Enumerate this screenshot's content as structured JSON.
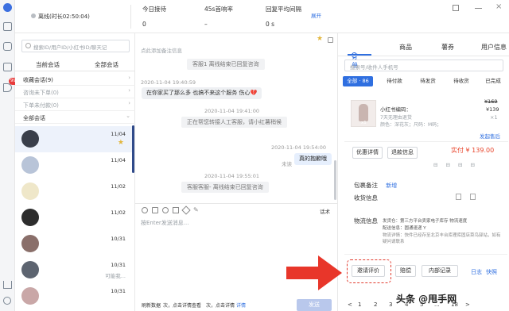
{
  "topbar": {
    "status": "离线(时长02:50:04)",
    "stats": [
      {
        "label": "今日接待",
        "value": "0"
      },
      {
        "label": "45s首响率",
        "value": "–"
      },
      {
        "label": "回复平均间隔",
        "value": "0 s"
      }
    ],
    "expand": "展开"
  },
  "rail": {
    "badge": "99+"
  },
  "sessions": {
    "search_placeholder": "搜索ID/用户ID/小红书ID/聊天记",
    "tabs": [
      "当前会话",
      "全部会话"
    ],
    "groups": [
      {
        "label": "收藏会话(9)"
      },
      {
        "label": "咨询未下单(0)"
      },
      {
        "label": "下单未付款(0)"
      },
      {
        "label": "全部会话"
      }
    ],
    "items": [
      {
        "date": "11/04",
        "starred": true,
        "preview": ""
      },
      {
        "date": "11/04",
        "starred": false,
        "preview": ""
      },
      {
        "date": "11/02",
        "starred": false,
        "preview": ""
      },
      {
        "date": "11/02",
        "starred": false,
        "preview": ""
      },
      {
        "date": "10/31",
        "starred": false,
        "preview": ""
      },
      {
        "date": "10/31",
        "starred": false,
        "preview": "可能我..."
      },
      {
        "date": "10/31",
        "starred": false,
        "preview": ""
      }
    ]
  },
  "chat": {
    "note_hint": "点此添加备注信息",
    "messages": [
      {
        "kind": "system",
        "text": "客服1      离线结束已回复咨询"
      },
      {
        "kind": "time",
        "text": "2020-11-04 19:40:59"
      },
      {
        "kind": "user",
        "text": "在你家买了那么多  也搞不来这个服务 伤心💔"
      },
      {
        "kind": "time",
        "text": "2020-11-04 19:41:00"
      },
      {
        "kind": "system",
        "text": "正在帮您转接人工客服，请小红薯稍候"
      },
      {
        "kind": "time",
        "text": "2020-11-04 19:54:00"
      },
      {
        "kind": "agent",
        "text": "真的抱歉哦",
        "status": "未读"
      },
      {
        "kind": "time",
        "text": "2020-11-04 19:55:01"
      },
      {
        "kind": "system",
        "text": "客服客服-      离线结束已回复咨询"
      }
    ],
    "script_label": "话术",
    "input_placeholder": "按Enter发送消息...",
    "footer_left": "刷新数据",
    "footer_mid": "次，点击详情查看",
    "footer_mid2": "次，点击详情",
    "footer_link": "详情",
    "send": "发送"
  },
  "panel": {
    "tabs": [
      "订单",
      "商品",
      "薯券",
      "用户信息"
    ],
    "search_placeholder": "搜索号/收件人手机号",
    "filters": [
      "全部 · 86",
      "待付款",
      "待发货",
      "待收货",
      "已完成"
    ],
    "order": {
      "shop": "小红书编码：",
      "subtitle": "7天无理由退货",
      "spec": "颜色：深花灰；尺码：M码；",
      "qty": "x1",
      "price_orig": "¥169",
      "price_now": "¥139",
      "count": "×1",
      "ship_link": "发起售后",
      "paid_label": "实付",
      "paid": "¥ 139.00",
      "detail_btn": "优惠详情",
      "refund_btn": "退款信息",
      "icons_row": "⊟ ⊟ ⊟ ⊟"
    },
    "fields": [
      {
        "label": "包裹备注",
        "value": "新增"
      },
      {
        "label": "收货信息",
        "value": ""
      },
      {
        "label": "物流信息",
        "value": "发货仓：第三方平台卖家电子库存  物流速度"
      }
    ],
    "logistics_lines": [
      "配送信息：圆通速递 Y",
      "物流详情：快件已经存至北京丰台库理库固店菜鸟驿站，如有疑问请联系"
    ],
    "action_buttons": [
      "邀请评价",
      "赔偿",
      "内部记录"
    ],
    "log_link": "日志",
    "quick_link": "快照",
    "pagination": [
      "<",
      "1",
      "2",
      "3",
      "4",
      "5",
      "...",
      "18",
      ">"
    ]
  },
  "watermark": "头条 @甩手网"
}
